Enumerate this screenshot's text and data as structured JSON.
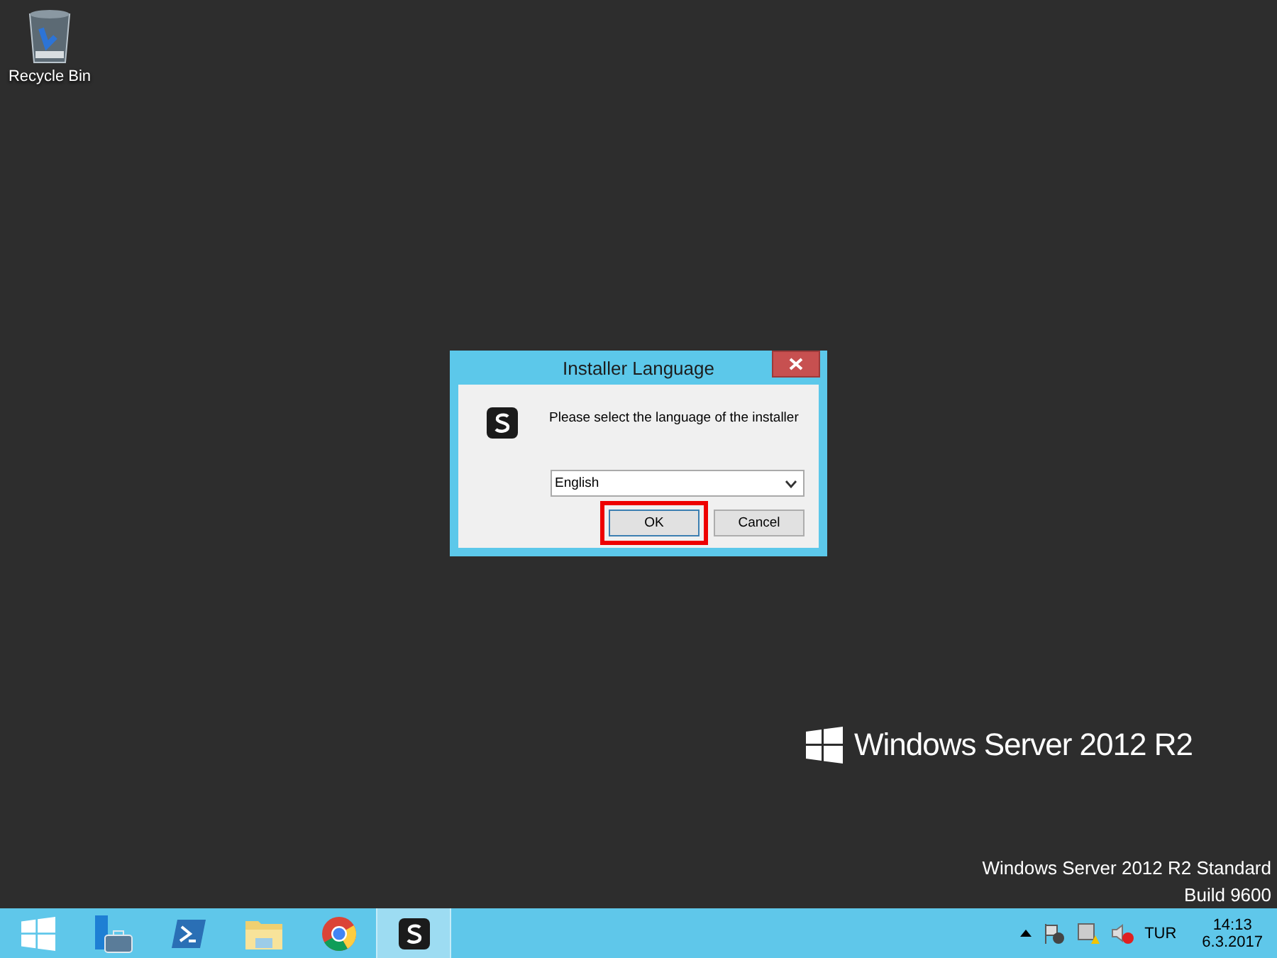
{
  "desktop": {
    "icons": [
      {
        "label": "Recycle Bin"
      }
    ],
    "branding": "Windows Server 2012 R2",
    "edition": "Windows Server 2012 R2 Standard",
    "build": "Build 9600"
  },
  "dialog": {
    "title": "Installer Language",
    "message": "Please select the language of the installer",
    "language": {
      "value": "English"
    },
    "buttons": [
      {
        "label": "OK",
        "highlighted": true
      },
      {
        "label": "Cancel",
        "highlighted": false
      }
    ]
  },
  "taskbar": {
    "apps": [
      {
        "kind": "server-manager",
        "selected": false
      },
      {
        "kind": "powershell",
        "selected": false
      },
      {
        "kind": "explorer",
        "selected": false
      },
      {
        "kind": "chrome",
        "selected": false
      },
      {
        "kind": "installer",
        "selected": true
      }
    ],
    "tray": {
      "language": "TUR",
      "time": "14:13",
      "date": "6.3.2017"
    }
  }
}
